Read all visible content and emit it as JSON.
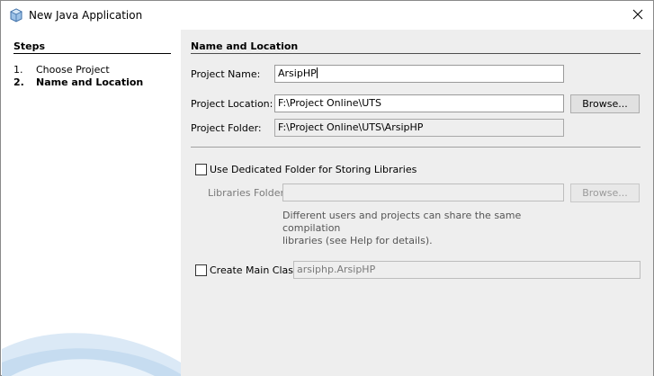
{
  "window": {
    "title": "New Java Application",
    "close_glyph": "✕"
  },
  "steps": {
    "title": "Steps",
    "items": [
      {
        "num": "1.",
        "label": "Choose Project",
        "active": false
      },
      {
        "num": "2.",
        "label": "Name and Location",
        "active": true
      }
    ]
  },
  "main": {
    "section_title": "Name and Location",
    "project_name": {
      "label": "Project Name:",
      "value": "ArsipHP"
    },
    "project_location": {
      "label": "Project Location:",
      "value": "F:\\Project Online\\UTS",
      "browse_label": "Browse..."
    },
    "project_folder": {
      "label": "Project Folder:",
      "value": "F:\\Project Online\\UTS\\ArsipHP"
    },
    "dedicated_folder": {
      "label": "Use Dedicated Folder for Storing Libraries",
      "checked": false
    },
    "libraries_folder": {
      "label": "Libraries Folder:",
      "value": "",
      "browse_label": "Browse..."
    },
    "hint_line1": "Different users and projects can share the same compilation",
    "hint_line2": "libraries (see Help for details).",
    "main_class": {
      "label": "Create Main Class",
      "checked": false,
      "value": "arsiphp.ArsipHP"
    }
  },
  "colors": {
    "panel_bg": "#eeeeee",
    "accent_blue": "#5b8fc7"
  }
}
